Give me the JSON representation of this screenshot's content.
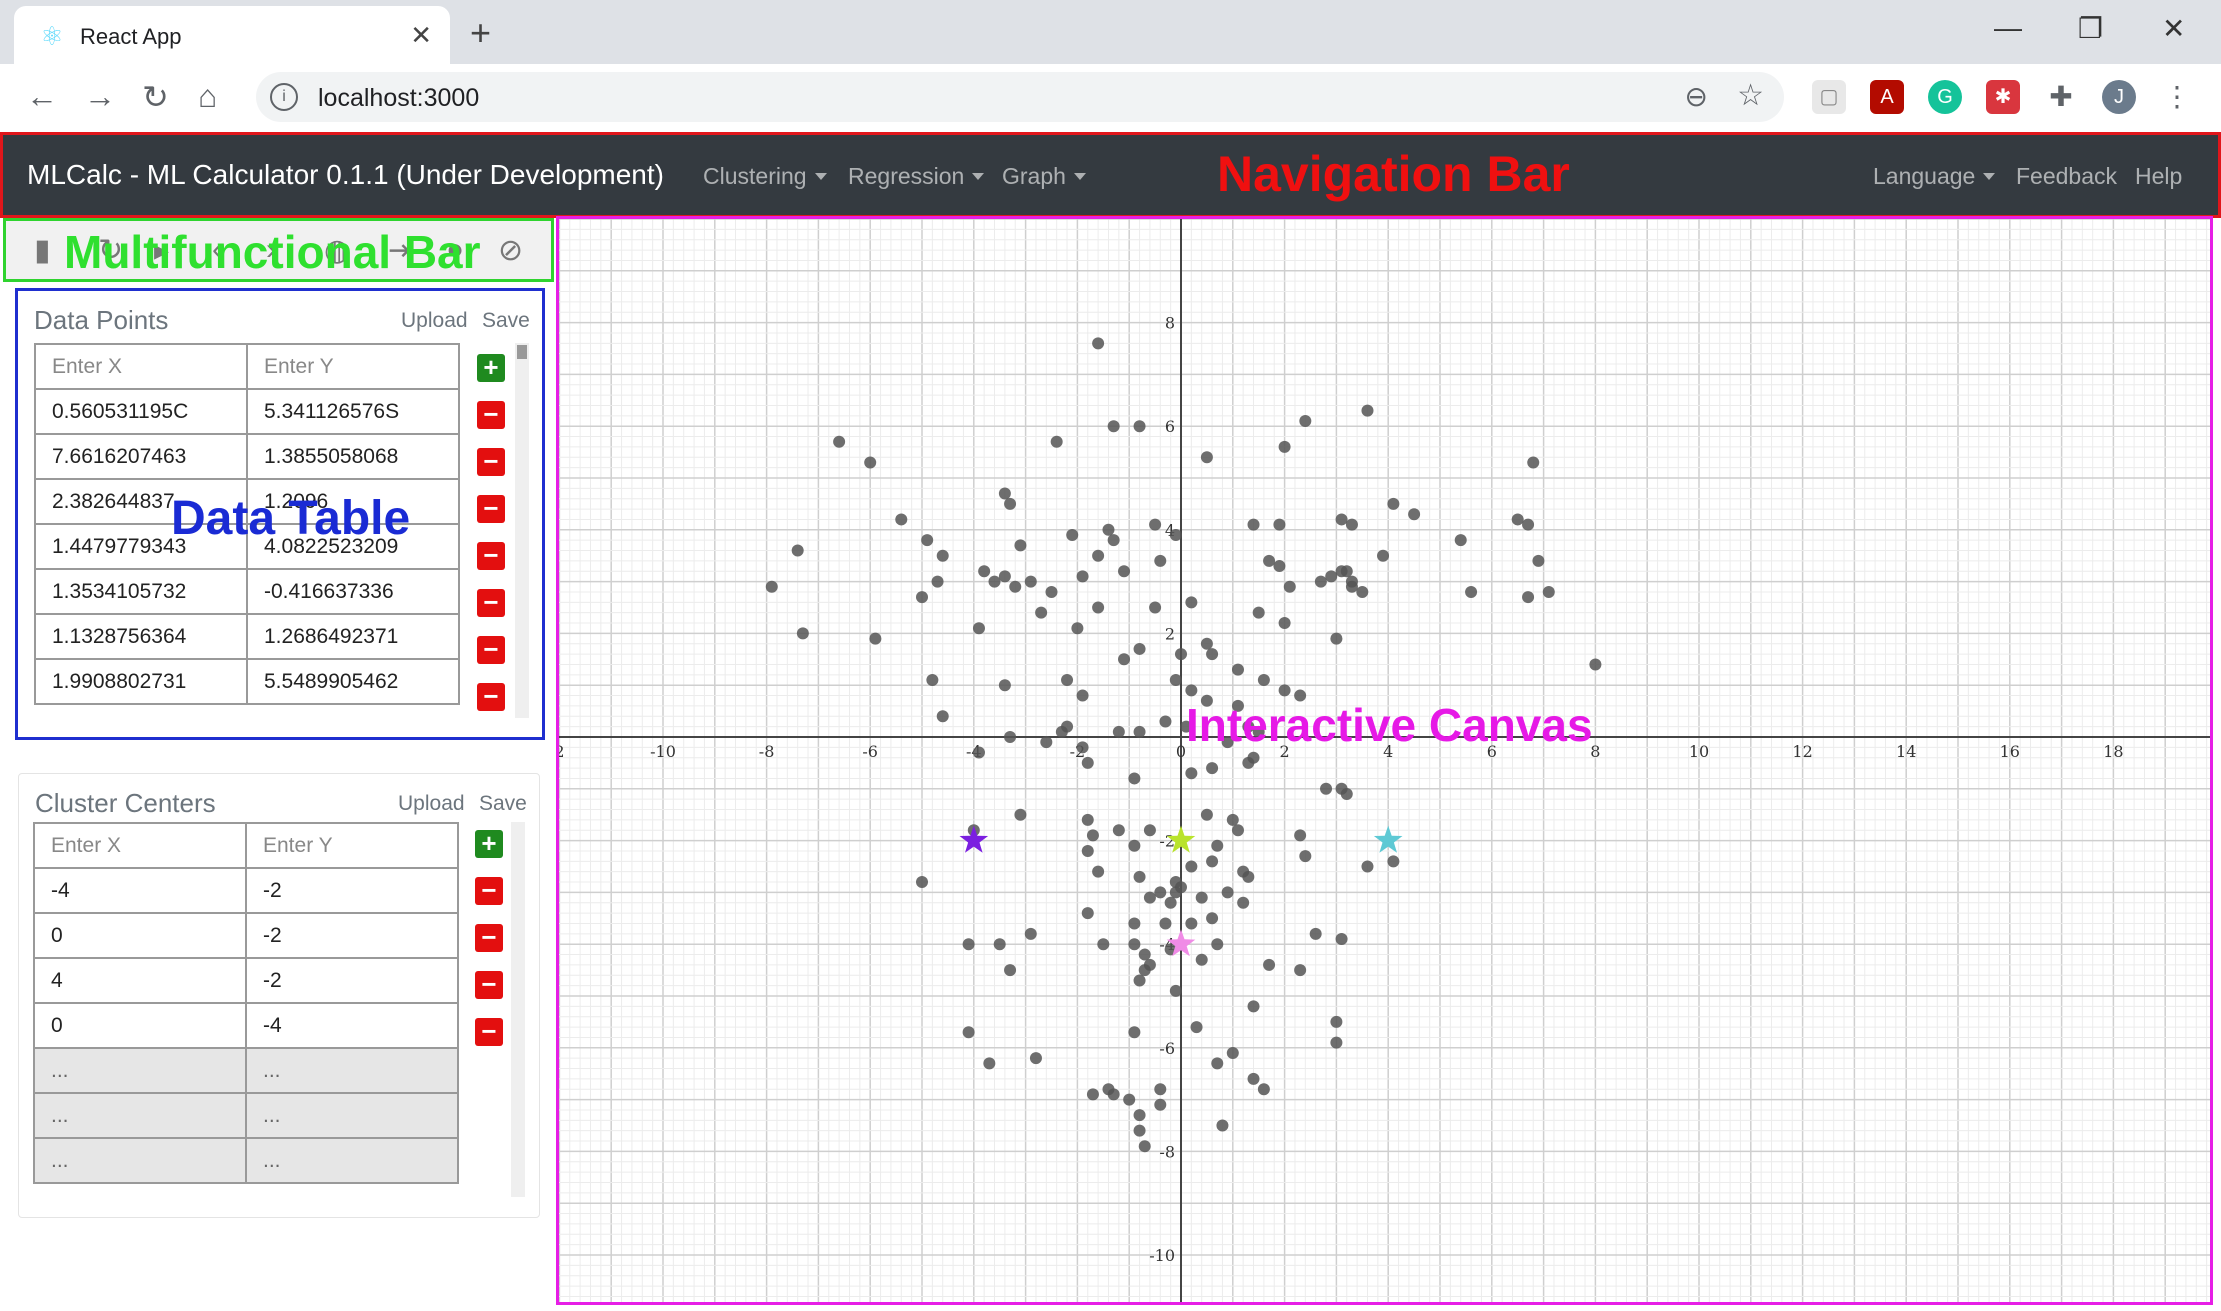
{
  "browser": {
    "tab_title": "React App",
    "url": "localhost:3000"
  },
  "navbar": {
    "brand": "MLCalc - ML Calculator 0.1.1 (Under Development)",
    "menus": [
      "Clustering",
      "Regression",
      "Graph"
    ],
    "right": {
      "language": "Language",
      "feedback": "Feedback",
      "help": "Help"
    }
  },
  "annotations": {
    "nav": "Navigation Bar",
    "multi": "Multifunctional Bar",
    "table": "Data Table",
    "canvas": "Interactive Canvas"
  },
  "data_points": {
    "title": "Data Points",
    "upload": "Upload",
    "save": "Save",
    "placeholder_x": "Enter X",
    "placeholder_y": "Enter Y",
    "rows": [
      [
        "0.560531195C",
        "5.341126576S"
      ],
      [
        "7.6616207463",
        "1.3855058068"
      ],
      [
        "2.382644837",
        "1.2096"
      ],
      [
        "1.4479779343",
        "4.0822523209"
      ],
      [
        "1.3534105732",
        "-0.416637336"
      ],
      [
        "1.1328756364",
        "1.2686492371"
      ],
      [
        "1.9908802731",
        "5.5489905462"
      ]
    ]
  },
  "cluster_centers": {
    "title": "Cluster Centers",
    "upload": "Upload",
    "save": "Save",
    "placeholder_x": "Enter X",
    "placeholder_y": "Enter Y",
    "rows": [
      [
        "-4",
        "-2"
      ],
      [
        "0",
        "-2"
      ],
      [
        "4",
        "-2"
      ],
      [
        "0",
        "-4"
      ]
    ],
    "empty_rows": [
      [
        "...",
        "..."
      ],
      [
        "...",
        "..."
      ],
      [
        "...",
        "..."
      ]
    ]
  },
  "chart_data": {
    "type": "scatter",
    "xlim": [
      -12,
      20
    ],
    "ylim": [
      -11,
      9
    ],
    "x_ticks": [
      "2",
      "-10",
      "-8",
      "-6",
      "-4",
      "-2",
      "0",
      "2",
      "4",
      "6",
      "8",
      "10",
      "12",
      "14",
      "16",
      "18"
    ],
    "y_ticks": [
      "8",
      "6",
      "4",
      "2",
      "-2",
      "-4",
      "-6",
      "-8",
      "-10"
    ],
    "grid": true,
    "point_color": "#555555",
    "points": [
      [
        -1.6,
        7.6
      ],
      [
        -1.3,
        6
      ],
      [
        -0.8,
        6
      ],
      [
        0.5,
        5.4
      ],
      [
        -2.4,
        5.7
      ],
      [
        -6.6,
        5.7
      ],
      [
        -6,
        5.3
      ],
      [
        2,
        5.6
      ],
      [
        2.4,
        6.1
      ],
      [
        3.6,
        6.3
      ],
      [
        -5.4,
        4.2
      ],
      [
        -3.4,
        4.7
      ],
      [
        -3.3,
        4.5
      ],
      [
        -4.9,
        3.8
      ],
      [
        -7.4,
        3.6
      ],
      [
        -4.6,
        3.5
      ],
      [
        -3.1,
        3.7
      ],
      [
        -2.1,
        3.9
      ],
      [
        -1.4,
        4
      ],
      [
        -1.3,
        3.8
      ],
      [
        -0.5,
        4.1
      ],
      [
        -0.1,
        3.9
      ],
      [
        1.4,
        4.1
      ],
      [
        1.9,
        4.1
      ],
      [
        3.1,
        4.2
      ],
      [
        3.3,
        4.1
      ],
      [
        4.1,
        4.5
      ],
      [
        4.5,
        4.3
      ],
      [
        5.4,
        3.8
      ],
      [
        6.5,
        4.2
      ],
      [
        6.7,
        4.1
      ],
      [
        6.8,
        5.3
      ],
      [
        -7.9,
        2.9
      ],
      [
        -4.7,
        3
      ],
      [
        -3.8,
        3.2
      ],
      [
        -3.6,
        3
      ],
      [
        -3.4,
        3.1
      ],
      [
        -3.2,
        2.9
      ],
      [
        -2.9,
        3
      ],
      [
        -2.5,
        2.8
      ],
      [
        -1.9,
        3.1
      ],
      [
        -1.6,
        3.5
      ],
      [
        -1.1,
        3.2
      ],
      [
        -0.4,
        3.4
      ],
      [
        1.7,
        3.4
      ],
      [
        1.9,
        3.3
      ],
      [
        2.1,
        2.9
      ],
      [
        2.7,
        3
      ],
      [
        2.9,
        3.1
      ],
      [
        3.1,
        3.2
      ],
      [
        3.2,
        3.2
      ],
      [
        3.3,
        3
      ],
      [
        3.3,
        2.9
      ],
      [
        3.5,
        2.8
      ],
      [
        3.9,
        3.5
      ],
      [
        5.6,
        2.8
      ],
      [
        6.7,
        2.7
      ],
      [
        6.9,
        3.4
      ],
      [
        7.1,
        2.8
      ],
      [
        -5,
        2.7
      ],
      [
        -2.7,
        2.4
      ],
      [
        -2,
        2.1
      ],
      [
        -1.6,
        2.5
      ],
      [
        -0.5,
        2.5
      ],
      [
        0.2,
        2.6
      ],
      [
        1.5,
        2.4
      ],
      [
        2,
        2.2
      ],
      [
        3,
        1.9
      ],
      [
        -7.3,
        2
      ],
      [
        -5.9,
        1.9
      ],
      [
        -3.9,
        2.1
      ],
      [
        -1.1,
        1.5
      ],
      [
        -0.8,
        1.7
      ],
      [
        0,
        1.6
      ],
      [
        0.5,
        1.8
      ],
      [
        0.6,
        1.6
      ],
      [
        1.1,
        1.3
      ],
      [
        1.6,
        1.1
      ],
      [
        2,
        0.9
      ],
      [
        2.3,
        0.8
      ],
      [
        -4.8,
        1.1
      ],
      [
        -3.4,
        1
      ],
      [
        -2.2,
        1.1
      ],
      [
        -1.9,
        0.8
      ],
      [
        -0.1,
        1.1
      ],
      [
        0.2,
        0.9
      ],
      [
        8,
        1.4
      ],
      [
        -4.6,
        0.4
      ],
      [
        -2.2,
        0.2
      ],
      [
        -1.2,
        0.1
      ],
      [
        -0.8,
        0.1
      ],
      [
        -0.3,
        0.3
      ],
      [
        0.1,
        0.2
      ],
      [
        0.5,
        0.7
      ],
      [
        1.1,
        0.6
      ],
      [
        1.3,
        0.2
      ],
      [
        1.5,
        0.1
      ],
      [
        0.9,
        -0.1
      ],
      [
        -3.3,
        0
      ],
      [
        -2.6,
        -0.1
      ],
      [
        -3.9,
        -0.3
      ],
      [
        -2.3,
        0.1
      ],
      [
        -1.9,
        -0.2
      ],
      [
        -1.8,
        -0.5
      ],
      [
        -0.9,
        -0.8
      ],
      [
        0.2,
        -0.7
      ],
      [
        0.6,
        -0.6
      ],
      [
        1.3,
        -0.5
      ],
      [
        1.4,
        -0.4
      ],
      [
        2.8,
        -1
      ],
      [
        3.1,
        -1
      ],
      [
        3.2,
        -1.1
      ],
      [
        -3.1,
        -1.5
      ],
      [
        -1.8,
        -1.6
      ],
      [
        -1.7,
        -1.9
      ],
      [
        -1.2,
        -1.8
      ],
      [
        -0.6,
        -1.8
      ],
      [
        0.5,
        -1.5
      ],
      [
        1,
        -1.6
      ],
      [
        1.1,
        -1.8
      ],
      [
        -4,
        -1.8
      ],
      [
        -1.8,
        -2.2
      ],
      [
        -0.9,
        -2.1
      ],
      [
        0.7,
        -2.1
      ],
      [
        2.3,
        -1.9
      ],
      [
        2.4,
        -2.3
      ],
      [
        3.6,
        -2.5
      ],
      [
        4.1,
        -2.4
      ],
      [
        -5,
        -2.8
      ],
      [
        -1.6,
        -2.6
      ],
      [
        -0.8,
        -2.7
      ],
      [
        -0.1,
        -2.8
      ],
      [
        0.2,
        -2.5
      ],
      [
        0.6,
        -2.4
      ],
      [
        1.2,
        -2.6
      ],
      [
        1.3,
        -2.7
      ],
      [
        -0.6,
        -3.1
      ],
      [
        -0.4,
        -3
      ],
      [
        -0.2,
        -3.2
      ],
      [
        -0.1,
        -3
      ],
      [
        0,
        -2.9
      ],
      [
        0.4,
        -3.1
      ],
      [
        0.9,
        -3
      ],
      [
        1.2,
        -3.2
      ],
      [
        -1.8,
        -3.4
      ],
      [
        -0.9,
        -3.6
      ],
      [
        -0.3,
        -3.6
      ],
      [
        0.2,
        -3.6
      ],
      [
        0.6,
        -3.5
      ],
      [
        -2.9,
        -3.8
      ],
      [
        -4.1,
        -4
      ],
      [
        -3.5,
        -4
      ],
      [
        -3.3,
        -4.5
      ],
      [
        -1.5,
        -4
      ],
      [
        -0.9,
        -4
      ],
      [
        -0.7,
        -4.2
      ],
      [
        -0.6,
        -4.4
      ],
      [
        -0.2,
        -4.1
      ],
      [
        0.4,
        -4.3
      ],
      [
        0.7,
        -4
      ],
      [
        2.6,
        -3.8
      ],
      [
        3.1,
        -3.9
      ],
      [
        -0.7,
        -4.5
      ],
      [
        -0.8,
        -4.7
      ],
      [
        -0.1,
        -4.9
      ],
      [
        1.7,
        -4.4
      ],
      [
        2.3,
        -4.5
      ],
      [
        1.4,
        -5.2
      ],
      [
        3,
        -5.5
      ],
      [
        3,
        -5.9
      ],
      [
        -4.1,
        -5.7
      ],
      [
        -3.7,
        -6.3
      ],
      [
        -2.8,
        -6.2
      ],
      [
        -0.9,
        -5.7
      ],
      [
        0.3,
        -5.6
      ],
      [
        1,
        -6.1
      ],
      [
        0.7,
        -6.3
      ],
      [
        1.4,
        -6.6
      ],
      [
        1.6,
        -6.8
      ],
      [
        -1.7,
        -6.9
      ],
      [
        -1.4,
        -6.8
      ],
      [
        -1.3,
        -6.9
      ],
      [
        -1,
        -7
      ],
      [
        -0.4,
        -6.8
      ],
      [
        -0.4,
        -7.1
      ],
      [
        -0.8,
        -7.3
      ],
      [
        -0.8,
        -7.6
      ],
      [
        -0.7,
        -7.9
      ],
      [
        0.8,
        -7.5
      ]
    ],
    "centers": [
      {
        "x": -4,
        "y": -2,
        "color": "#7b1fe0"
      },
      {
        "x": 0,
        "y": -2,
        "color": "#b9e32c"
      },
      {
        "x": 4,
        "y": -2,
        "color": "#5ec9d4"
      },
      {
        "x": 0,
        "y": -4,
        "color": "#f08be6"
      }
    ]
  }
}
